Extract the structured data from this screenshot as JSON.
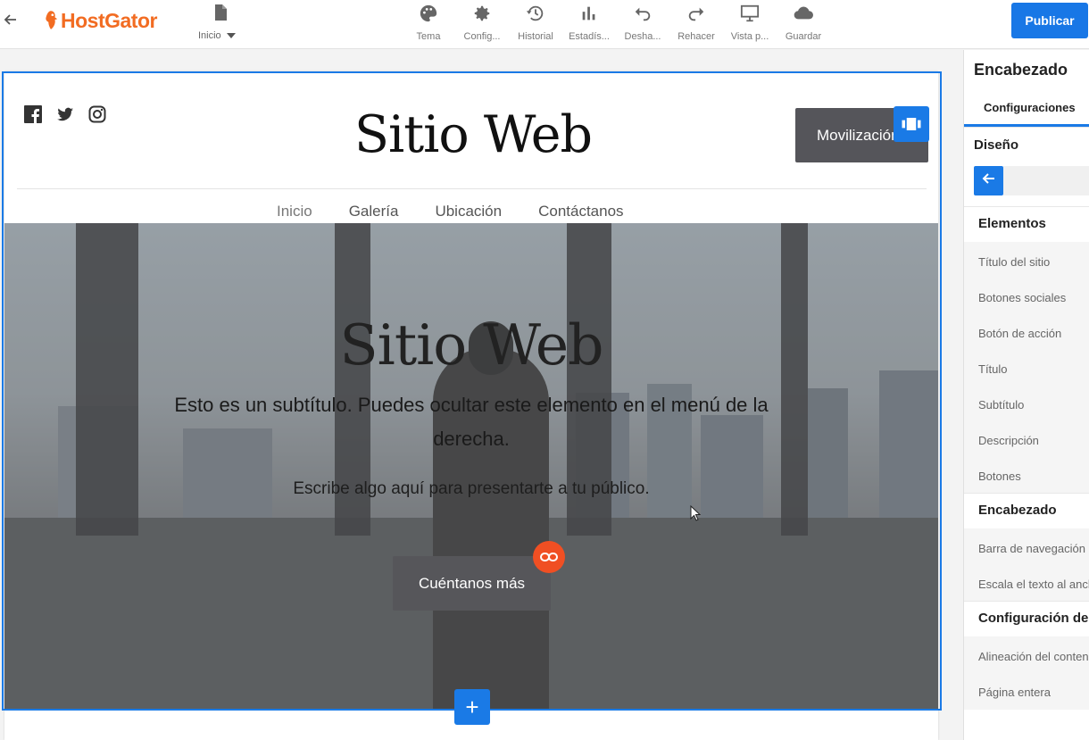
{
  "topbar": {
    "logo_text": "HostGator",
    "page_label": "Inicio",
    "tools": [
      {
        "label": "Tema",
        "icon": "palette-icon"
      },
      {
        "label": "Config...",
        "icon": "gear-icon"
      },
      {
        "label": "Historial",
        "icon": "history-icon"
      },
      {
        "label": "Estadís...",
        "icon": "stats-icon"
      },
      {
        "label": "Desha...",
        "icon": "undo-icon"
      },
      {
        "label": "Rehacer",
        "icon": "redo-icon"
      },
      {
        "label": "Vista p...",
        "icon": "monitor-icon"
      },
      {
        "label": "Guardar",
        "icon": "cloud-icon"
      }
    ],
    "publish_label": "Publicar"
  },
  "site": {
    "title": "Sitio Web",
    "cta_label": "Movilización",
    "nav": [
      "Inicio",
      "Galería",
      "Ubicación",
      "Contáctanos"
    ],
    "hero": {
      "title": "Sitio Web",
      "subtitle": "Esto es un subtítulo. Puedes ocultar este elemento en el menú de la derecha.",
      "description": "Escribe algo aquí para presentarte a tu público.",
      "button_label": "Cuéntanos más"
    }
  },
  "panel": {
    "title": "Encabezado",
    "tab": "Configuraciones",
    "design": "Diseño",
    "sections": [
      {
        "title": "Elementos",
        "items": [
          "Título del sitio",
          "Botones sociales",
          "Botón de acción",
          "Título",
          "Subtítulo",
          "Descripción",
          "Botones"
        ]
      },
      {
        "title": "Encabezado",
        "items": [
          "Barra de navegación",
          "Escala el texto al ancho"
        ]
      },
      {
        "title": "Configuración del",
        "items": [
          "Alineación del contenido",
          "Página entera"
        ]
      }
    ]
  },
  "colors": {
    "accent": "#1877e6",
    "brand": "#f26c22",
    "link_badge": "#f04f23"
  }
}
